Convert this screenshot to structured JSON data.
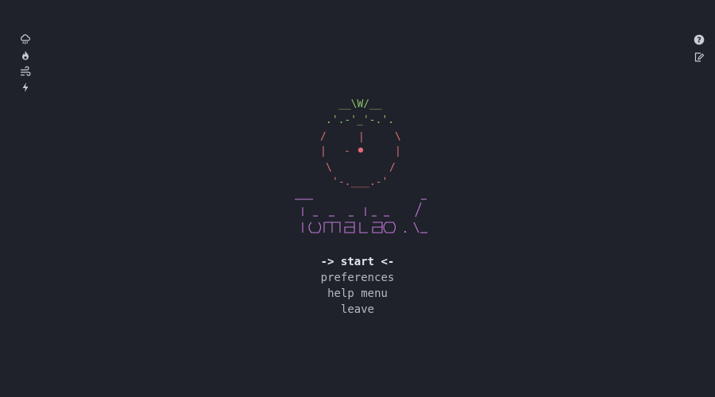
{
  "left_toolbar": [
    {
      "icon": "rain-cloud-icon"
    },
    {
      "icon": "flame-icon"
    },
    {
      "icon": "wind-icon"
    },
    {
      "icon": "lightning-icon"
    }
  ],
  "right_toolbar": [
    {
      "icon": "help-icon",
      "glyph": "?"
    },
    {
      "icon": "edit-note-icon"
    }
  ],
  "colors": {
    "background": "#1f222a",
    "stem": "#8fbf6a",
    "tomato": "#e06c75",
    "title": "#c678dd",
    "text": "#b4b8c0"
  },
  "menu": {
    "start": "-> start <-",
    "preferences": "preferences",
    "help": "help menu",
    "leave": "leave"
  }
}
